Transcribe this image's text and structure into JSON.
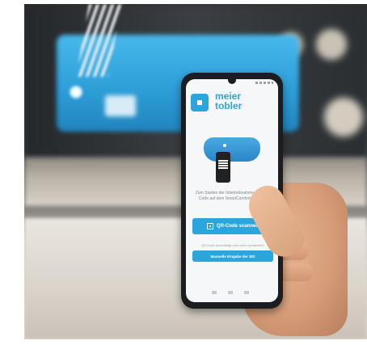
{
  "app": {
    "brand_line1": "meier",
    "brand_line2": "tobler",
    "scan_instruction": "Zum Starten der Inbetriebnahme den QR-Code auf dem SmartComfort scannen",
    "scan_button_label": "QR-Code scannen",
    "hint_text": "QR-Code beschädigt oder nicht vorhanden?",
    "manual_button_label": "Manuelle Eingabe der SID"
  },
  "icons": {
    "logo": "meier-tobler-logo-icon",
    "qr": "qr-code-icon"
  },
  "colors": {
    "brand_blue": "#2aa6dd",
    "device_blue": "#2e9fd8"
  }
}
